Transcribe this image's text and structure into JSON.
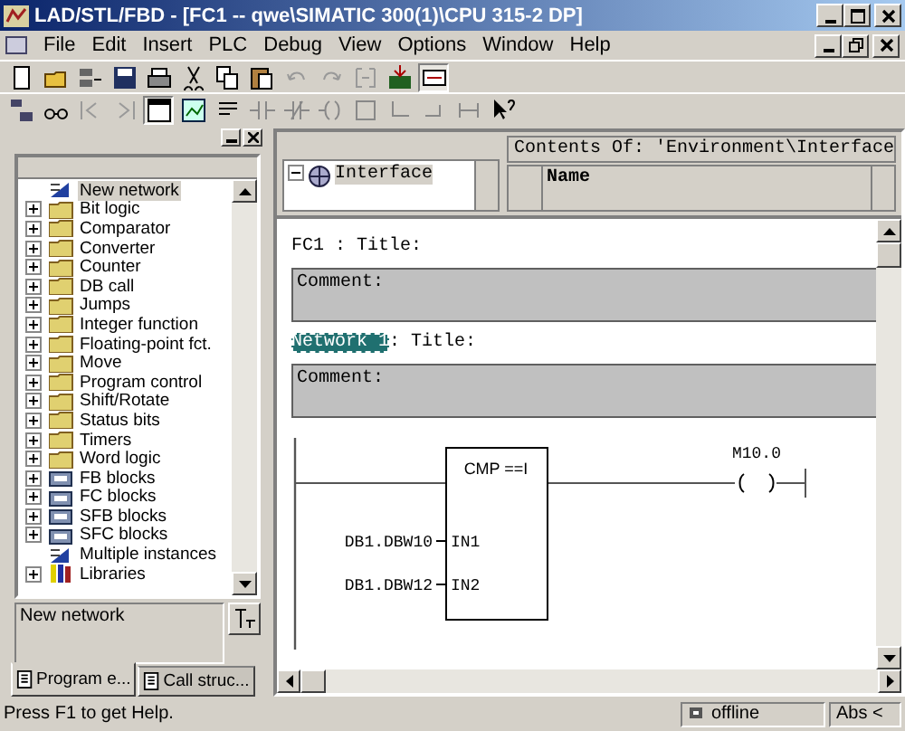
{
  "window": {
    "title": "LAD/STL/FBD  - [FC1 -- qwe\\SIMATIC 300(1)\\CPU 315-2 DP]"
  },
  "menu": [
    "File",
    "Edit",
    "Insert",
    "PLC",
    "Debug",
    "View",
    "Options",
    "Window",
    "Help"
  ],
  "catalog": {
    "items": [
      {
        "label": "New network",
        "kind": "element",
        "selected": true
      },
      {
        "label": "Bit logic",
        "kind": "folder",
        "selected": false
      },
      {
        "label": "Comparator",
        "kind": "folder",
        "selected": false
      },
      {
        "label": "Converter",
        "kind": "folder",
        "selected": false
      },
      {
        "label": "Counter",
        "kind": "folder",
        "selected": false
      },
      {
        "label": "DB call",
        "kind": "folder",
        "selected": false
      },
      {
        "label": "Jumps",
        "kind": "folder",
        "selected": false
      },
      {
        "label": "Integer function",
        "kind": "folder",
        "selected": false
      },
      {
        "label": "Floating-point fct.",
        "kind": "folder",
        "selected": false
      },
      {
        "label": "Move",
        "kind": "folder",
        "selected": false
      },
      {
        "label": "Program control",
        "kind": "folder",
        "selected": false
      },
      {
        "label": "Shift/Rotate",
        "kind": "folder",
        "selected": false
      },
      {
        "label": "Status bits",
        "kind": "folder",
        "selected": false
      },
      {
        "label": "Timers",
        "kind": "folder",
        "selected": false
      },
      {
        "label": "Word logic",
        "kind": "folder",
        "selected": false
      },
      {
        "label": "FB blocks",
        "kind": "block",
        "selected": false
      },
      {
        "label": "FC blocks",
        "kind": "block",
        "selected": false
      },
      {
        "label": "SFB blocks",
        "kind": "block",
        "selected": false
      },
      {
        "label": "SFC blocks",
        "kind": "block",
        "selected": false
      },
      {
        "label": "Multiple instances",
        "kind": "element",
        "selected": false
      },
      {
        "label": "Libraries",
        "kind": "library",
        "selected": false
      }
    ],
    "description": "New network",
    "tabs": [
      {
        "label": "Program e...",
        "selected": true
      },
      {
        "label": "Call struc...",
        "selected": false
      }
    ]
  },
  "interface": {
    "tree_item": "Interface",
    "contents_label": "Contents Of: 'Environment\\Interface",
    "column": "Name"
  },
  "editor": {
    "block_title": "FC1 : Title:",
    "block_comment": "Comment:",
    "network_label": "Network 1",
    "network_title": ": Title:",
    "network_comment": "Comment:",
    "ladder": {
      "box": "CMP ==I",
      "coil": "M10.0",
      "inputs": [
        {
          "operand": "DB1.DBW10",
          "pin": "IN1"
        },
        {
          "operand": "DB1.DBW12",
          "pin": "IN2"
        }
      ]
    }
  },
  "status_bar": {
    "help": "Press F1 to get Help.",
    "mode": "offline",
    "address": "Abs <"
  }
}
